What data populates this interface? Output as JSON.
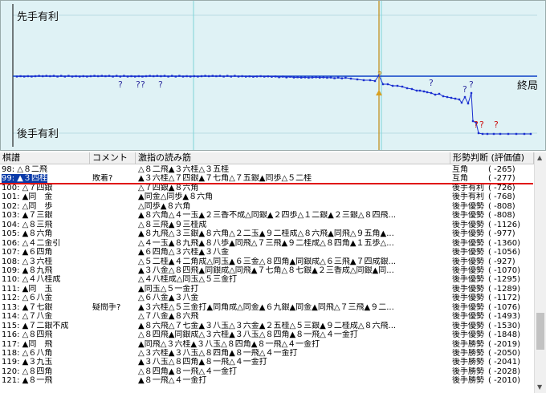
{
  "graph": {
    "label_top": "先手有利",
    "label_bottom": "後手有利",
    "label_end": "終局",
    "question_mark": "?",
    "colors": {
      "background": "#dff2f5",
      "line": "#1a2fd0",
      "zero_axis": "#0b40c8",
      "cursor": "#c08a10",
      "mistake": "#cc1111"
    }
  },
  "table": {
    "headers": [
      "棋譜",
      "コメント",
      "激指の読み筋",
      "形勢判断 (評価値)"
    ],
    "rows": [
      {
        "move": "98: △８二飛",
        "comment": "",
        "line": "△８二飛▲３六桂△３五桂",
        "judge": "互角",
        "value": "( -265)"
      },
      {
        "move": "99: ▲３四桂",
        "comment": "敗着?",
        "line": "▲３六桂△７四銀▲７七角△７五銀▲同歩△５二桂",
        "judge": "互角",
        "value": "( -277)",
        "selected": true
      },
      {
        "move": "100: △７四銀",
        "comment": "",
        "line": "△７四銀▲８六角",
        "judge": "後手有利",
        "value": "( -726)"
      },
      {
        "move": "101: ▲同　金",
        "comment": "",
        "line": "▲同金△同歩▲８六角",
        "judge": "後手有利",
        "value": "( -768)"
      },
      {
        "move": "102: △同　歩",
        "comment": "",
        "line": "△同歩▲８六角",
        "judge": "後手優勢",
        "value": "( -808)"
      },
      {
        "move": "103: ▲７三銀",
        "comment": "",
        "line": "▲８六角△４一玉▲２三香不成△同銀▲２四歩△１二銀▲２三銀△８四飛...",
        "judge": "後手優勢",
        "value": "( -808)"
      },
      {
        "move": "104: △８三飛",
        "comment": "",
        "line": "△８三飛▲９三桂成",
        "judge": "後手優勢",
        "value": "( -1126)"
      },
      {
        "move": "105: ▲８六角",
        "comment": "",
        "line": "▲８九飛△３三銀▲８六角△２二玉▲９二桂成△８六飛▲同飛△９五角▲...",
        "judge": "後手優勢",
        "value": "( -977)"
      },
      {
        "move": "106: △４二金引",
        "comment": "",
        "line": "△４一玉▲８九飛▲８八歩▲同飛△７三飛▲９二桂成△８四角▲１五歩△...",
        "judge": "後手優勢",
        "value": "( -1360)"
      },
      {
        "move": "107: ▲６四角",
        "comment": "",
        "line": "▲６四角△３六桂▲３八金",
        "judge": "後手優勢",
        "value": "( -1056)"
      },
      {
        "move": "108: △３六桂",
        "comment": "",
        "line": "△５二桂▲４二角成△同玉▲６三金△８四角▲同銀成△６三飛▲７四成銀...",
        "judge": "後手優勢",
        "value": "( -927)"
      },
      {
        "move": "109: ▲８九飛",
        "comment": "",
        "line": "▲３八金△８四飛▲同銀成△同飛▲７七角△８七銀▲２三香成△同銀▲同...",
        "judge": "後手優勢",
        "value": "( -1070)"
      },
      {
        "move": "110: △４八桂成",
        "comment": "",
        "line": "△４八桂成△同玉△５三金打",
        "judge": "後手優勢",
        "value": "( -1295)"
      },
      {
        "move": "111: ▲同　玉",
        "comment": "",
        "line": "▲同玉△５一金打",
        "judge": "後手優勢",
        "value": "( -1289)"
      },
      {
        "move": "112: △６八金",
        "comment": "",
        "line": "△６八金▲３八金",
        "judge": "後手優勢",
        "value": "( -1172)"
      },
      {
        "move": "113: ▲７七銀",
        "comment": "疑問手?",
        "line": "▲３六桂△５三金打▲同角成△同金▲６九銀▲同金▲同飛△７三飛▲９二...",
        "judge": "後手優勢",
        "value": "( -1076)"
      },
      {
        "move": "114: △７八金",
        "comment": "",
        "line": "△７八金▲８六飛",
        "judge": "後手優勢",
        "value": "( -1493)"
      },
      {
        "move": "115: ▲７二銀不成",
        "comment": "",
        "line": "▲８六飛△７七金▲３八玉△３六金▲２五桂△５三銀▲９二桂成△８六飛...",
        "judge": "後手優勢",
        "value": "( -1530)"
      },
      {
        "move": "116: △８四飛",
        "comment": "",
        "line": "△８四飛▲同銀成△３六桂▲３八玉△８四角▲８一飛△４一金打",
        "judge": "後手優勢",
        "value": "( -1848)"
      },
      {
        "move": "117: ▲同　飛",
        "comment": "",
        "line": "▲同飛△３六桂▲３八玉△８四角▲８一飛△４一金打",
        "judge": "後手勝勢",
        "value": "( -2019)"
      },
      {
        "move": "118: △６八角",
        "comment": "",
        "line": "△３六桂▲３八玉△８四角▲８一飛△４一金打",
        "judge": "後手勝勢",
        "value": "( -2050)"
      },
      {
        "move": "119: ▲３九玉",
        "comment": "",
        "line": "▲３八玉△８四角▲８一飛△４一金打",
        "judge": "後手勝勢",
        "value": "( -2041)"
      },
      {
        "move": "120: △８四角",
        "comment": "",
        "line": "△８四角▲８一飛△４一金打",
        "judge": "後手勝勢",
        "value": "( -2028)"
      },
      {
        "move": "121: ▲８一飛",
        "comment": "",
        "line": "▲８一飛△４一金打",
        "judge": "後手勝勢",
        "value": "( -2010)"
      }
    ]
  }
}
